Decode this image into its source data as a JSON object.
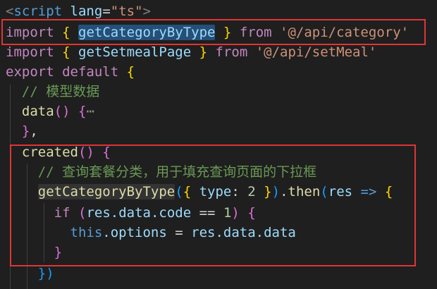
{
  "code": {
    "l1": {
      "lt": "<",
      "tagname": "script",
      "attr": "lang",
      "eq": "=",
      "val": "\"ts\"",
      "gt": ">"
    },
    "l2": {
      "kw": "import",
      "ob": "{",
      "name": "getCategoryByType",
      "cb": "}",
      "from": "from",
      "path": "'@/api/category'"
    },
    "l3": {
      "kw": "import",
      "ob": "{",
      "name": "getSetmealPage",
      "cb": "}",
      "from": "from",
      "path": "'@/api/setMeal'"
    },
    "l4": {
      "kw": "export",
      "kw2": "default",
      "ob": "{"
    },
    "l5": {
      "comment": "// 模型数据"
    },
    "l6": {
      "fn": "data",
      "parens": "()",
      "ob": "{",
      "fold": "⋯"
    },
    "l7": {
      "cb": "}",
      "comma": ","
    },
    "l8": {
      "fn": "created",
      "parens": "()",
      "ob": "{"
    },
    "l9": {
      "comment": "// 查询套餐分类，用于填充查询页面的下拉框"
    },
    "l10": {
      "fn": "getCategoryByType",
      "op": "(",
      "ob": "{",
      "key": "type",
      "colon": ":",
      "num": "2",
      "cb": "}",
      "cp": ")",
      "dot": ".",
      "then": "then",
      "op2": "(",
      "res": "res",
      "arrow": "=>",
      "ob2": "{"
    },
    "l11": {
      "kw": "if",
      "op": "(",
      "expr": "res.data.code",
      "eqop": "==",
      "num": "1",
      "cp": ")",
      "ob": "{"
    },
    "l12": {
      "this": "this",
      "rest": ".options",
      "eq": "=",
      "rhs": "res.data.data"
    },
    "l13": {
      "cb": "}"
    },
    "l14": {
      "cb": "})"
    }
  },
  "colors": {
    "background": "#1f1f1f",
    "highlight_box": "#e03535",
    "selection": "#264f78",
    "keyword": "#569cd6",
    "control_keyword": "#c586c0",
    "string": "#ce9178",
    "function": "#dcdcaa",
    "variable": "#9cdcfe",
    "number": "#b5cea8",
    "comment": "#6a9955"
  }
}
